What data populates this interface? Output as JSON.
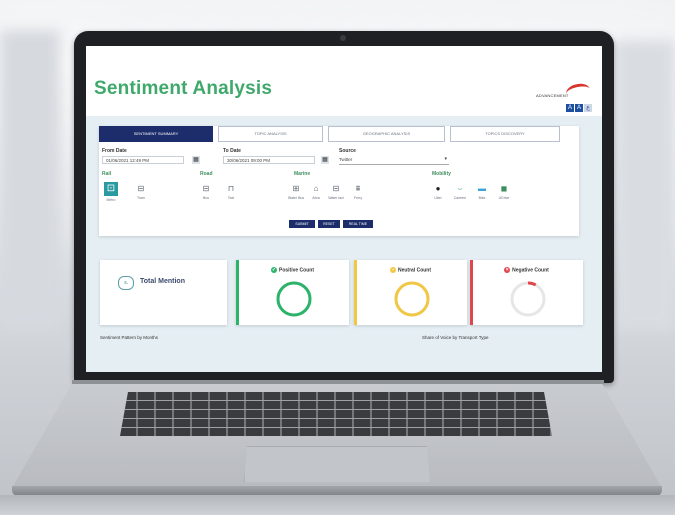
{
  "app": {
    "title": "Sentiment Analysis",
    "logo_text": "ADVANCEMENT"
  },
  "lang": [
    "A",
    "A",
    "ع"
  ],
  "tabs": [
    {
      "label": "SENTIMENT SUMMARY",
      "active": true
    },
    {
      "label": "TOPIC ANALYSIS",
      "active": false
    },
    {
      "label": "GEOGRAPHIC ANALYSIS",
      "active": false
    },
    {
      "label": "TOPICS DISCOVERY",
      "active": false
    }
  ],
  "filters": {
    "from_label": "From Date",
    "from_value": "01/06/2021 12:49 PM",
    "to_label": "To Date",
    "to_value": "30/06/2021 09:00 PM",
    "source_label": "Source",
    "source_value": "Twitter"
  },
  "categories": {
    "rail": "Rail",
    "road": "Road",
    "marine": "Marine",
    "mobility": "Mobility"
  },
  "transport": [
    {
      "label": "Metro",
      "icon": "metro-icon",
      "glyph": "⊡",
      "selected": true
    },
    {
      "label": "Tram",
      "icon": "tram-icon",
      "glyph": "⊟",
      "selected": false
    },
    {
      "label": "Bus",
      "icon": "bus-icon",
      "glyph": "⊟",
      "selected": false
    },
    {
      "label": "Taxi",
      "icon": "taxi-icon",
      "glyph": "⊓",
      "selected": false
    },
    {
      "label": "Water Bus",
      "icon": "water-bus-icon",
      "glyph": "⊞",
      "selected": false
    },
    {
      "label": "Abra",
      "icon": "abra-icon",
      "glyph": "⌂",
      "selected": false
    },
    {
      "label": "Water taxi",
      "icon": "water-taxi-icon",
      "glyph": "⊟",
      "selected": false
    },
    {
      "label": "Ferry",
      "icon": "ferry-icon",
      "glyph": "⩩",
      "selected": false
    },
    {
      "label": "Uber",
      "icon": "uber-icon",
      "glyph": "●",
      "selected": false
    },
    {
      "label": "Careem",
      "icon": "careem-icon",
      "glyph": "⌣",
      "selected": false
    },
    {
      "label": "Bike",
      "icon": "bike-icon",
      "glyph": "▬",
      "selected": false
    },
    {
      "label": "UDrive",
      "icon": "udrive-icon",
      "glyph": "◼",
      "selected": false
    }
  ],
  "buttons": {
    "submit": "SUBMIT",
    "reset": "RESET",
    "realtime": "REAL TIME"
  },
  "cards": {
    "total_mention": "Total Mention",
    "positive": "Positive Count",
    "neutral": "Neutral Count",
    "negative": "Negative Count"
  },
  "gauges": {
    "positive": 1.0,
    "neutral": 1.0,
    "negative": 0.08
  },
  "colors": {
    "title_green": "#3fa86b",
    "tab_navy": "#1d2d6b",
    "positive": "#2bb36a",
    "neutral": "#f2c744",
    "negative": "#e0464e"
  },
  "sections": {
    "left": "Sentiment Pattern by Months",
    "right": "Share of Voice by Transport Type"
  }
}
